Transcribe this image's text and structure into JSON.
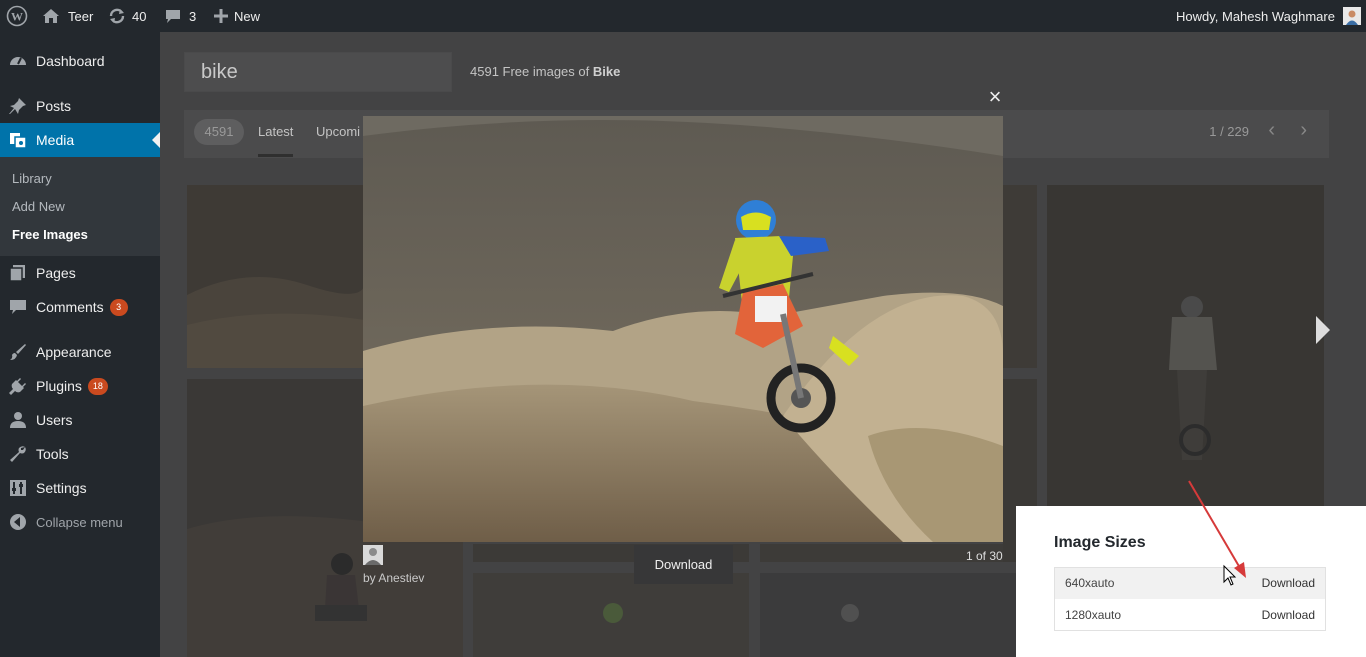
{
  "adminbar": {
    "site_name": "Teer",
    "updates": "40",
    "comments": "3",
    "new_label": "New",
    "greeting": "Howdy, Mahesh Waghmare"
  },
  "sidebar": {
    "items": [
      {
        "label": "Dashboard",
        "icon": "dashboard-icon"
      },
      {
        "label": "Posts",
        "icon": "pin-icon"
      },
      {
        "label": "Media",
        "icon": "media-icon"
      },
      {
        "label": "Pages",
        "icon": "pages-icon"
      },
      {
        "label": "Comments",
        "icon": "comment-icon",
        "badge": "3"
      },
      {
        "label": "Appearance",
        "icon": "brush-icon"
      },
      {
        "label": "Plugins",
        "icon": "plug-icon",
        "badge": "18"
      },
      {
        "label": "Users",
        "icon": "user-icon"
      },
      {
        "label": "Tools",
        "icon": "wrench-icon"
      },
      {
        "label": "Settings",
        "icon": "settings-icon"
      }
    ],
    "submenu": [
      "Library",
      "Add New",
      "Free Images"
    ],
    "collapse_label": "Collapse menu"
  },
  "search": {
    "value": "bike",
    "result_count_prefix": "4591 Free images of",
    "result_term": "Bike"
  },
  "filters": {
    "count": "4591",
    "tabs": [
      "Latest",
      "Upcomi"
    ],
    "page_info": "1 / 229"
  },
  "lightbox": {
    "close_label": "×",
    "author": "by Anestiev",
    "download_label": "Download",
    "counter": "1 of 30"
  },
  "image_sizes": {
    "title": "Image Sizes",
    "rows": [
      {
        "name": "640xauto",
        "action": "Download"
      },
      {
        "name": "1280xauto",
        "action": "Download"
      }
    ]
  }
}
